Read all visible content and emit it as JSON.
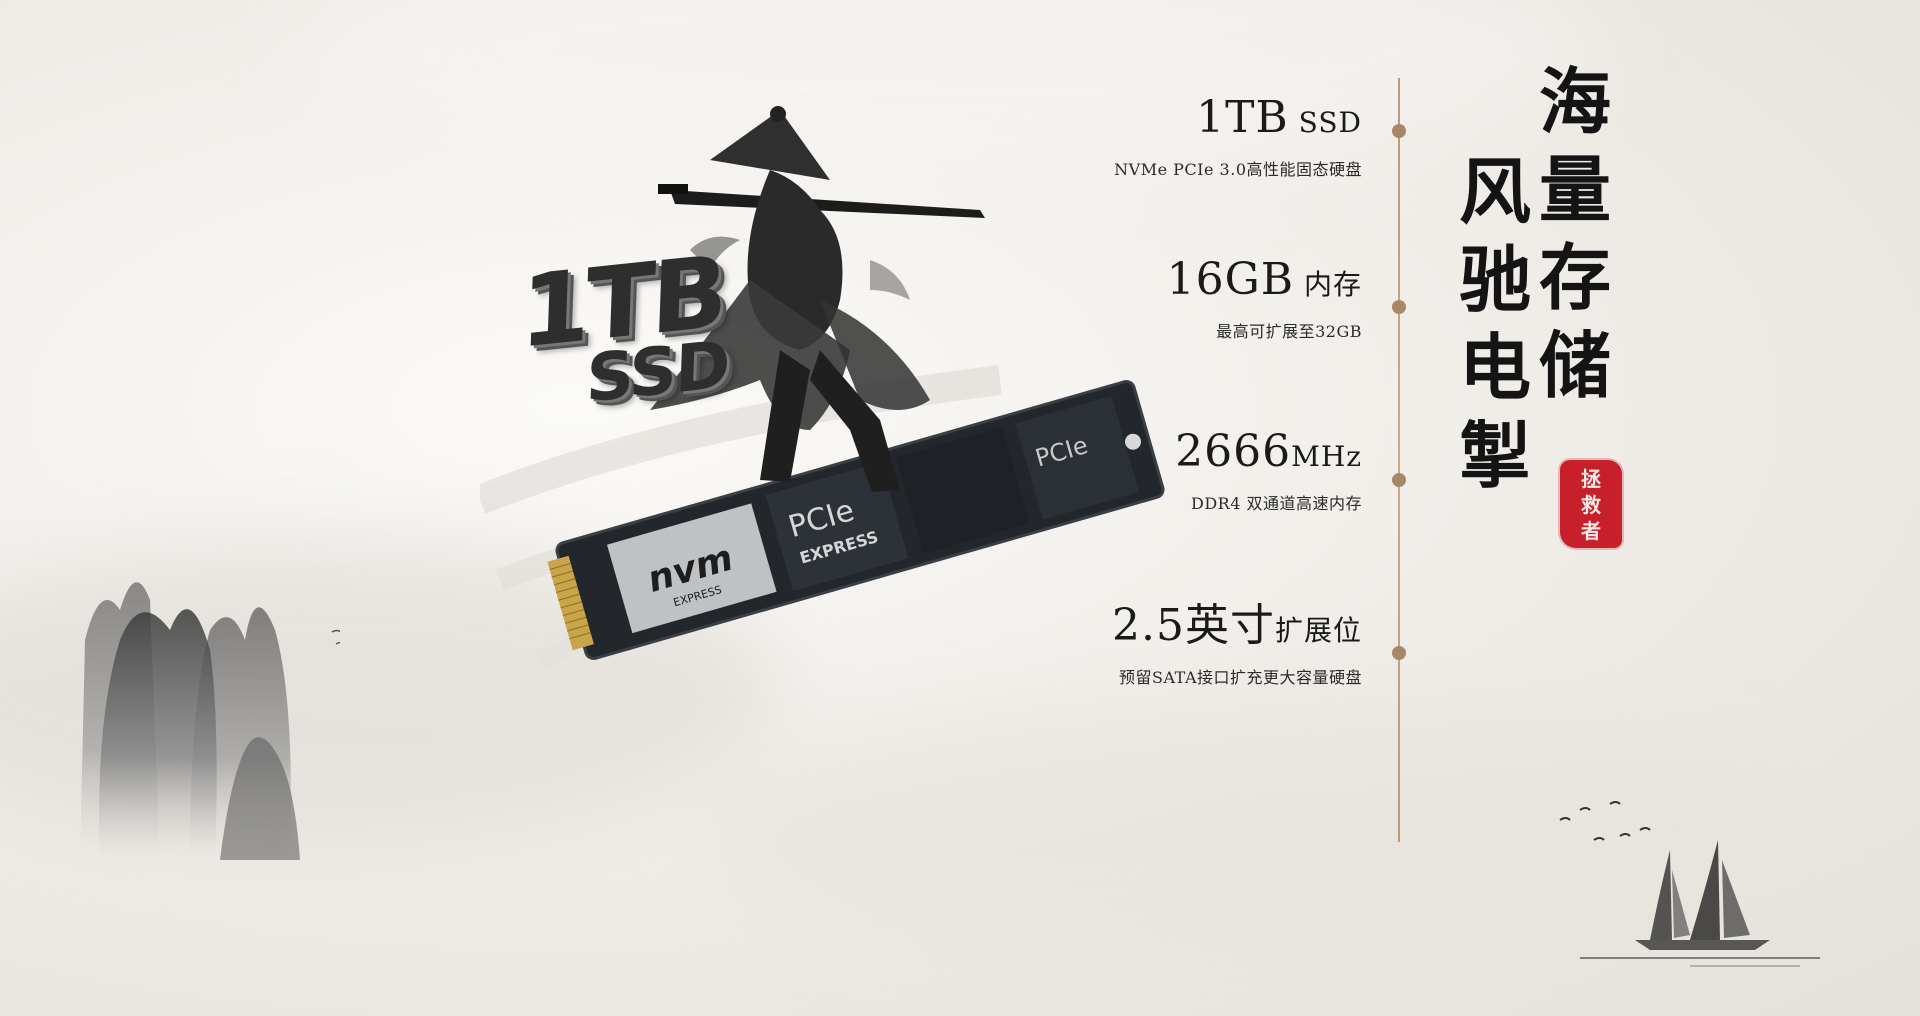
{
  "badge": {
    "line1": "1TB",
    "line2": "SSD"
  },
  "ssd": {
    "label_pcie": "PCIe",
    "label_express": "EXPRESS",
    "label_nvm": "nvm",
    "label_nvm_sub": "EXPRESS"
  },
  "specs": [
    {
      "main": "1TB",
      "unit": " SSD",
      "sub": "NVMe PCIe 3.0高性能固态硬盘"
    },
    {
      "main": "16GB",
      "unit": " 内存",
      "sub": "最高可扩展至32GB"
    },
    {
      "main": "2666",
      "unit": "MHz",
      "sub": "DDR4 双通道高速内存"
    },
    {
      "main": "2.5英寸",
      "unit": "扩展位",
      "sub": "预留SATA接口扩充更大容量硬盘"
    }
  ],
  "calligraphy": {
    "col_right": [
      "海",
      "量",
      "存",
      "储"
    ],
    "col_left": [
      "风",
      "驰",
      "电",
      "掣"
    ]
  },
  "seal": {
    "chars": [
      "拯",
      "救",
      "者"
    ]
  },
  "colors": {
    "seal_red": "#c8202b",
    "accent_line": "#b79a7a",
    "ink": "#141414"
  }
}
